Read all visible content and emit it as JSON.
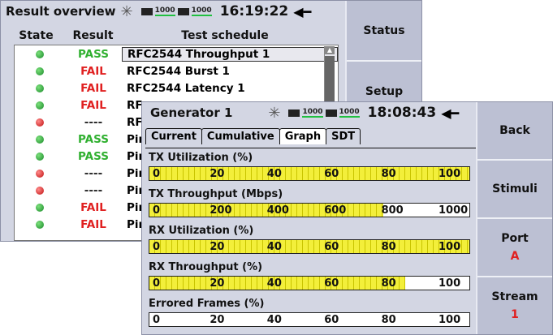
{
  "back_window": {
    "title": "Result overview",
    "status": {
      "rate1": "1000",
      "rate2": "1000",
      "time": "16:19:22"
    },
    "table": {
      "headers": [
        "State",
        "Result",
        "Test schedule"
      ],
      "rows": [
        {
          "state": "green",
          "result": "PASS",
          "test": "RFC2544 Throughput 1"
        },
        {
          "state": "green",
          "result": "FAIL",
          "test": "RFC2544 Burst 1"
        },
        {
          "state": "green",
          "result": "FAIL",
          "test": "RFC2544 Latency 1"
        },
        {
          "state": "green",
          "result": "FAIL",
          "test": "RF"
        },
        {
          "state": "red",
          "result": "----",
          "test": "RF"
        },
        {
          "state": "green",
          "result": "PASS",
          "test": "Pin"
        },
        {
          "state": "green",
          "result": "PASS",
          "test": "Pin"
        },
        {
          "state": "red",
          "result": "----",
          "test": "Pin"
        },
        {
          "state": "red",
          "result": "----",
          "test": "Pin"
        },
        {
          "state": "green",
          "result": "FAIL",
          "test": "Pin"
        },
        {
          "state": "green",
          "result": "FAIL",
          "test": "Pin"
        }
      ]
    },
    "side": {
      "status": "Status",
      "setup": "Setup"
    }
  },
  "front_window": {
    "title": "Generator 1",
    "status": {
      "rate1": "1000",
      "rate2": "1000",
      "time": "18:08:43"
    },
    "tabs": [
      "Current",
      "Cumulative",
      "Graph",
      "SDT"
    ],
    "active_tab": "Graph",
    "graphs": [
      {
        "label": "TX Utilization (%)",
        "ticks": [
          "0",
          "20",
          "40",
          "60",
          "80",
          "100"
        ],
        "fill": 1.0
      },
      {
        "label": "TX Throughput (Mbps)",
        "ticks": [
          "0",
          "200",
          "400",
          "600",
          "800",
          "1000"
        ],
        "fill": 0.73
      },
      {
        "label": "RX Utilization (%)",
        "ticks": [
          "0",
          "20",
          "40",
          "60",
          "80",
          "100"
        ],
        "fill": 1.0
      },
      {
        "label": "RX Throughput (%)",
        "ticks": [
          "0",
          "20",
          "40",
          "60",
          "80",
          "100"
        ],
        "fill": 0.8
      },
      {
        "label": "Errored Frames (%)",
        "ticks": [
          "0",
          "20",
          "40",
          "60",
          "80",
          "100"
        ],
        "fill": 0.0
      }
    ],
    "side": {
      "back": "Back",
      "stimuli": "Stimuli",
      "port": "Port",
      "port_value": "A",
      "stream": "Stream",
      "stream_value": "1"
    }
  },
  "colors": {
    "pass": "#30b030",
    "fail": "#e02020",
    "bar_fill": "#f3ef3a",
    "panel": "#d3d6e3"
  }
}
